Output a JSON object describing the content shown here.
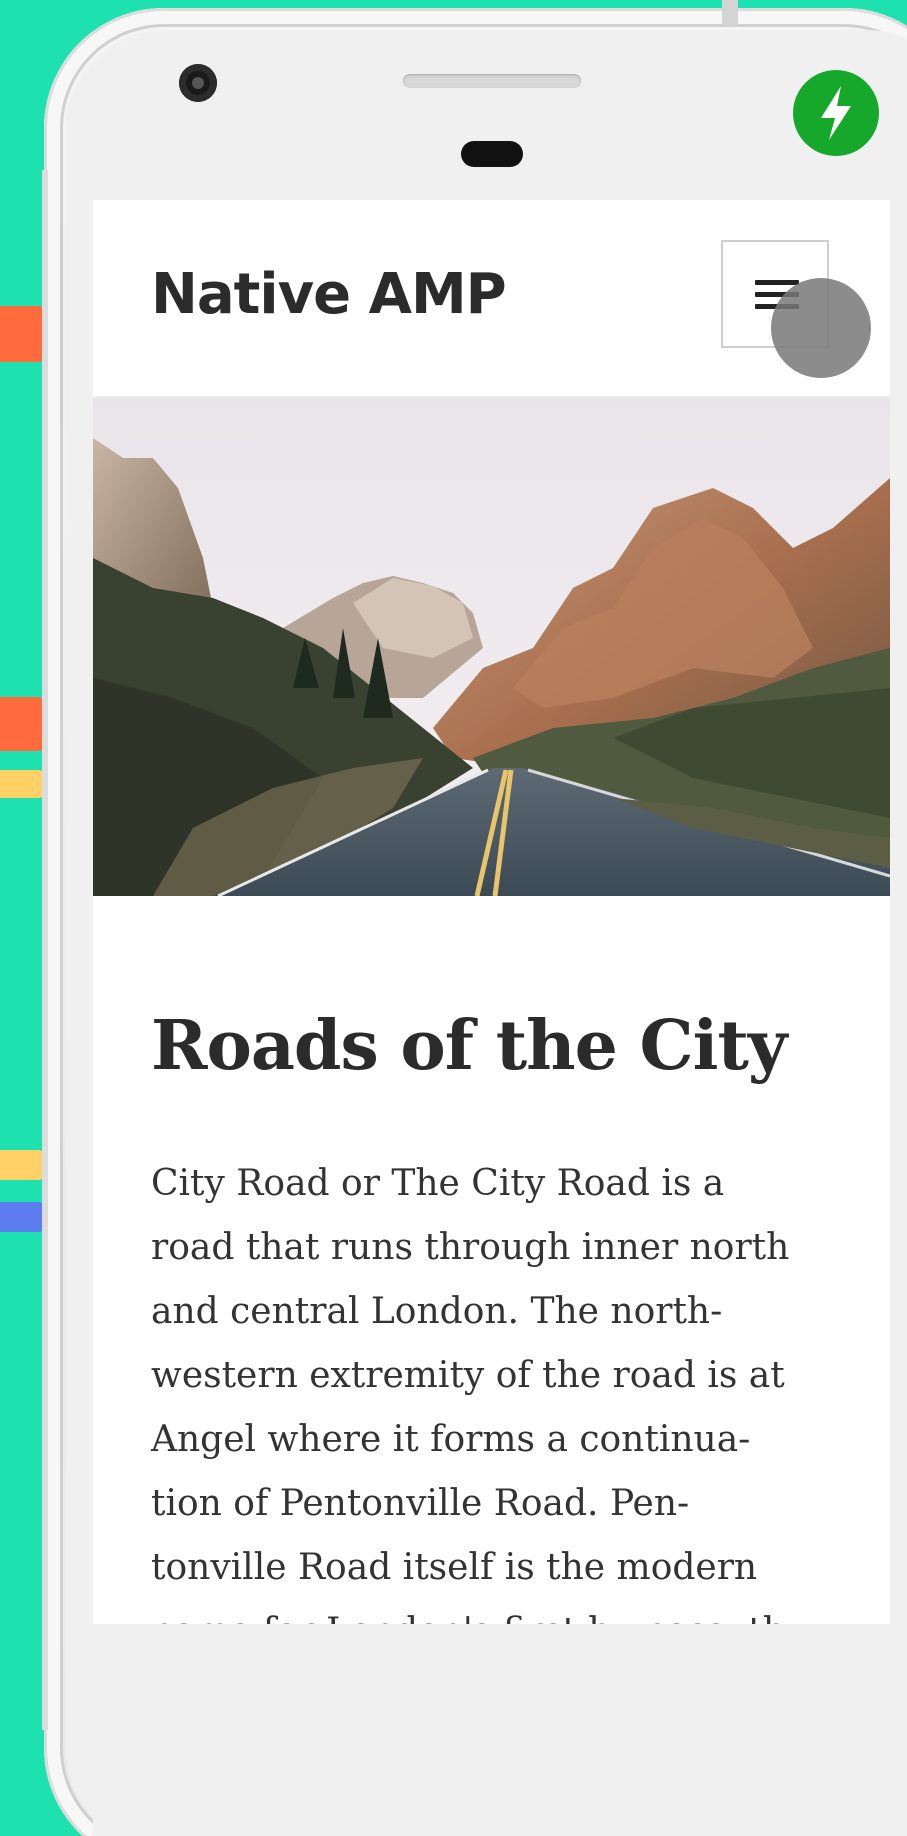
{
  "colors": {
    "background": "#1de2b0",
    "amp_badge": "#16a82a",
    "accent_orange": "#ff6b3d",
    "accent_yellow": "#ffd166",
    "accent_blue": "#5c7cf0"
  },
  "header": {
    "site_title": "Native AMP",
    "menu_icon": "hamburger-menu-icon"
  },
  "status_bar": {
    "amp_icon": "lightning-bolt-icon"
  },
  "hero": {
    "image": "mountain-road-photo"
  },
  "article": {
    "title": "Roads of the City",
    "body_lines": [
      "City Road or The City Road is a",
      "road that runs through inner north",
      "and central London. The north-",
      "western extremity of the road is at",
      "Angel where it forms a continua-",
      "tion of Pentonville Road. Pen-",
      "tonville Road itself is the modern",
      "name for London's first by-pass, th"
    ]
  }
}
